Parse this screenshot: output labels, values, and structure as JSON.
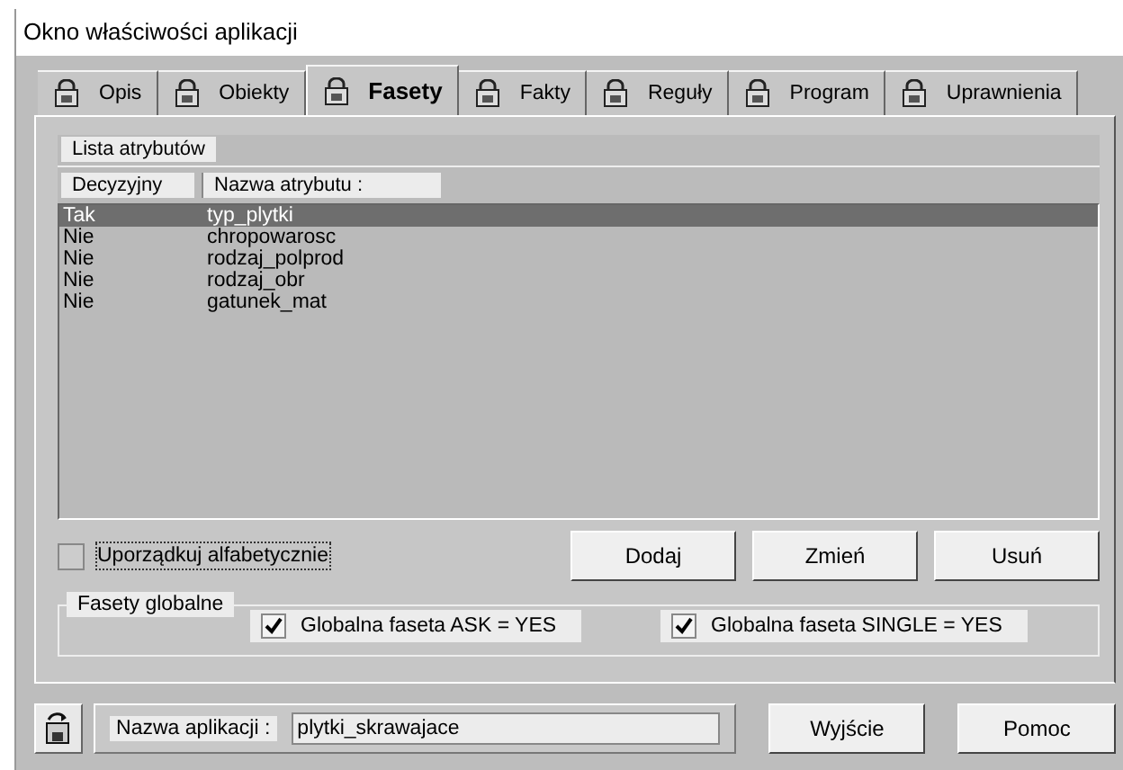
{
  "window": {
    "title": "Okno właściwości aplikacji"
  },
  "tabs": [
    {
      "label": "Opis",
      "selected": false
    },
    {
      "label": "Obiekty",
      "selected": false
    },
    {
      "label": "Fasety",
      "selected": true
    },
    {
      "label": "Fakty",
      "selected": false
    },
    {
      "label": "Reguły",
      "selected": false
    },
    {
      "label": "Program",
      "selected": false
    },
    {
      "label": "Uprawnienia",
      "selected": false
    }
  ],
  "list": {
    "title": "Lista atrybutów",
    "columns": [
      "Decyzyjny",
      "Nazwa atrybutu :"
    ],
    "rows": [
      {
        "cells": [
          "Tak",
          "typ_plytki"
        ],
        "selected": true
      },
      {
        "cells": [
          "Nie",
          "chropowarosc"
        ],
        "selected": false
      },
      {
        "cells": [
          "Nie",
          "rodzaj_polprod"
        ],
        "selected": false
      },
      {
        "cells": [
          "Nie",
          "rodzaj_obr"
        ],
        "selected": false
      },
      {
        "cells": [
          "Nie",
          "gatunek_mat"
        ],
        "selected": false
      }
    ]
  },
  "sort_checkbox": {
    "label": "Uporządkuj alfabetycznie",
    "checked": false
  },
  "buttons": [
    "Dodaj",
    "Zmień",
    "Usuń"
  ],
  "global_facets": {
    "title": "Fasety globalne",
    "options": [
      {
        "label": "Globalna faseta  ASK = YES",
        "checked": true
      },
      {
        "label": "Globalna faseta  SINGLE = YES",
        "checked": true
      }
    ]
  },
  "footer": {
    "app_name_label": "Nazwa aplikacji  :",
    "app_name_value": "plytki_skrawajace",
    "buttons": [
      "Wyjście",
      "Pomoc"
    ]
  }
}
